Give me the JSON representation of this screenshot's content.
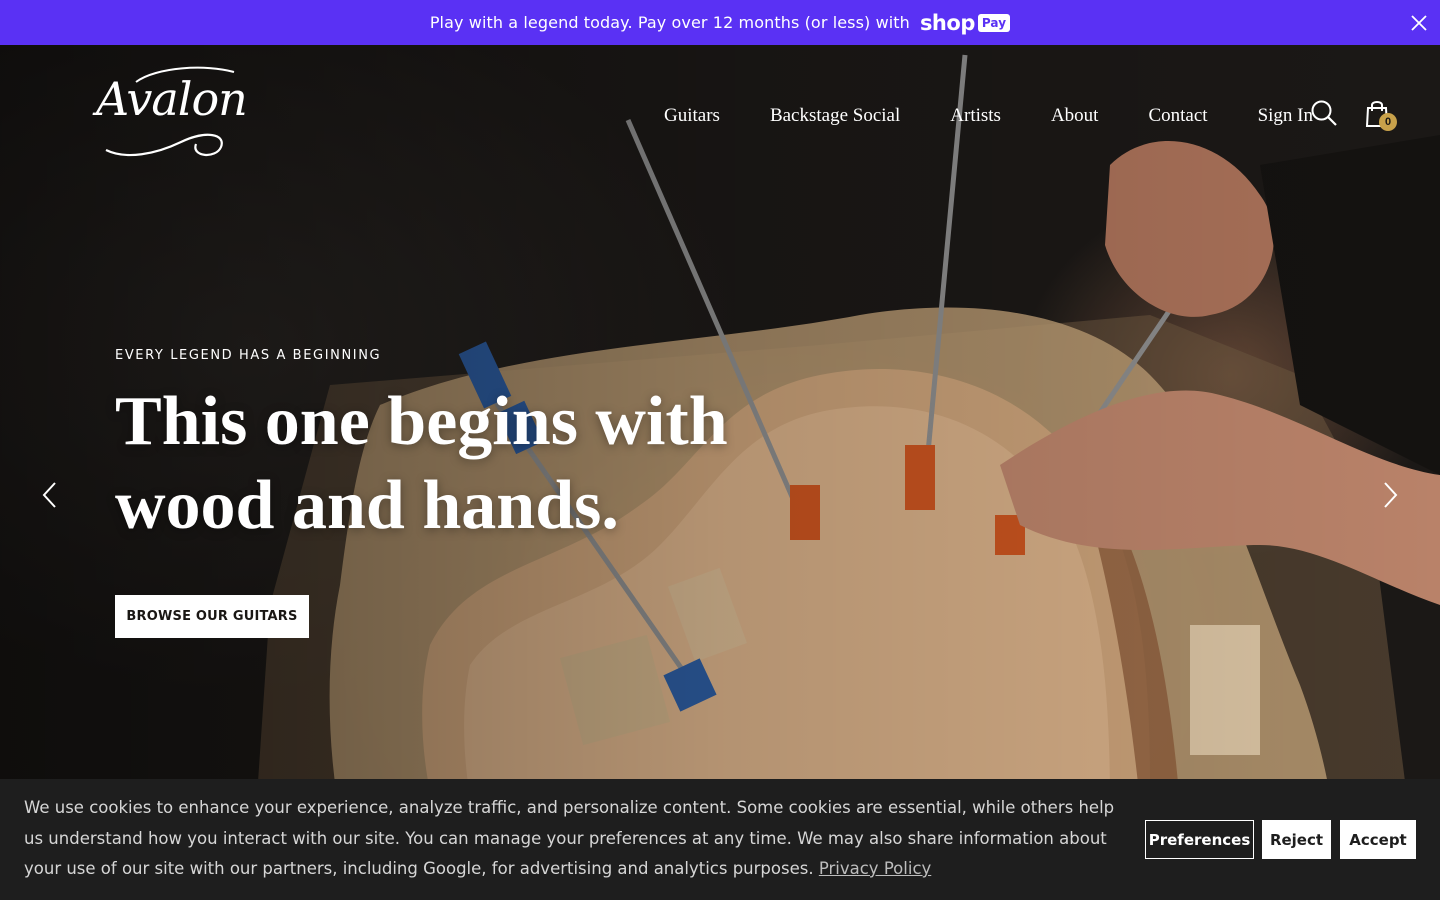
{
  "announcement": {
    "text": "Play with a legend today. Pay over 12 months (or less) with",
    "shop_word": "shop",
    "pay_word": "Pay",
    "close_icon": "close-icon",
    "background": "#5a31f4"
  },
  "header": {
    "logo": "Avalon",
    "nav": [
      "Guitars",
      "Backstage Social",
      "Artists",
      "About",
      "Contact",
      "Sign In"
    ],
    "search_icon": "search-icon",
    "cart_icon": "shopping-bag-icon",
    "cart_count": "0"
  },
  "hero": {
    "eyebrow": "EVERY LEGEND HAS A BEGINNING",
    "headline_line1": "This one begins with",
    "headline_line2": "wood and hands.",
    "cta": "BROWSE OUR GUITARS",
    "prev_icon": "chevron-left-icon",
    "next_icon": "chevron-right-icon"
  },
  "cookie": {
    "text": "We use cookies to enhance your experience, analyze traffic, and personalize content. Some cookies are essential, while others help us understand how you interact with our site. You can manage your preferences at any time. We may also share information about your use of our site with our partners, including Google, for advertising and analytics purposes.",
    "policy_link": "Privacy Policy",
    "buttons": {
      "preferences": "Preferences",
      "reject": "Reject",
      "accept": "Accept"
    }
  }
}
